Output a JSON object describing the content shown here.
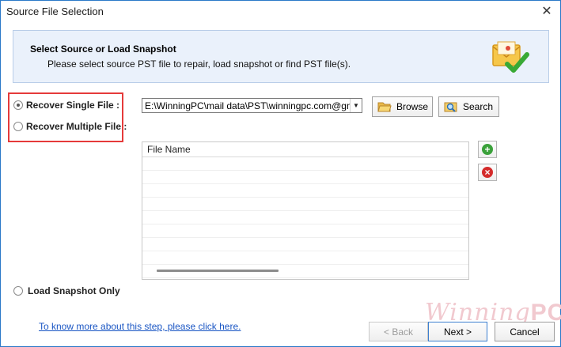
{
  "window": {
    "title": "Source File Selection",
    "close_glyph": "✕"
  },
  "header": {
    "title": "Select Source or Load Snapshot",
    "subtitle": "Please select source PST file to repair, load snapshot or find PST file(s).",
    "icon": "envelope-check-icon"
  },
  "options": {
    "single": "Recover Single File :",
    "multiple": "Recover Multiple File :",
    "snapshot": "Load Snapshot Only",
    "selected": "single"
  },
  "path": {
    "value": "E:\\WinningPC\\mail data\\PST\\winningpc.com@gmail.c",
    "arrow": "▼"
  },
  "buttons": {
    "browse": "Browse",
    "search": "Search"
  },
  "file_list": {
    "column_header": "File Name",
    "rows": []
  },
  "side_buttons": {
    "add": "+",
    "remove": "×"
  },
  "help_link": "To know more about this step, please click here.",
  "watermark": {
    "left": "Winning",
    "right": "PC"
  },
  "nav": {
    "back": "< Back",
    "next": "Next >",
    "cancel": "Cancel"
  },
  "colors": {
    "accent": "#2b79c8",
    "highlight": "#e53a3a",
    "add": "#3aa13a",
    "remove": "#d42b2b"
  }
}
